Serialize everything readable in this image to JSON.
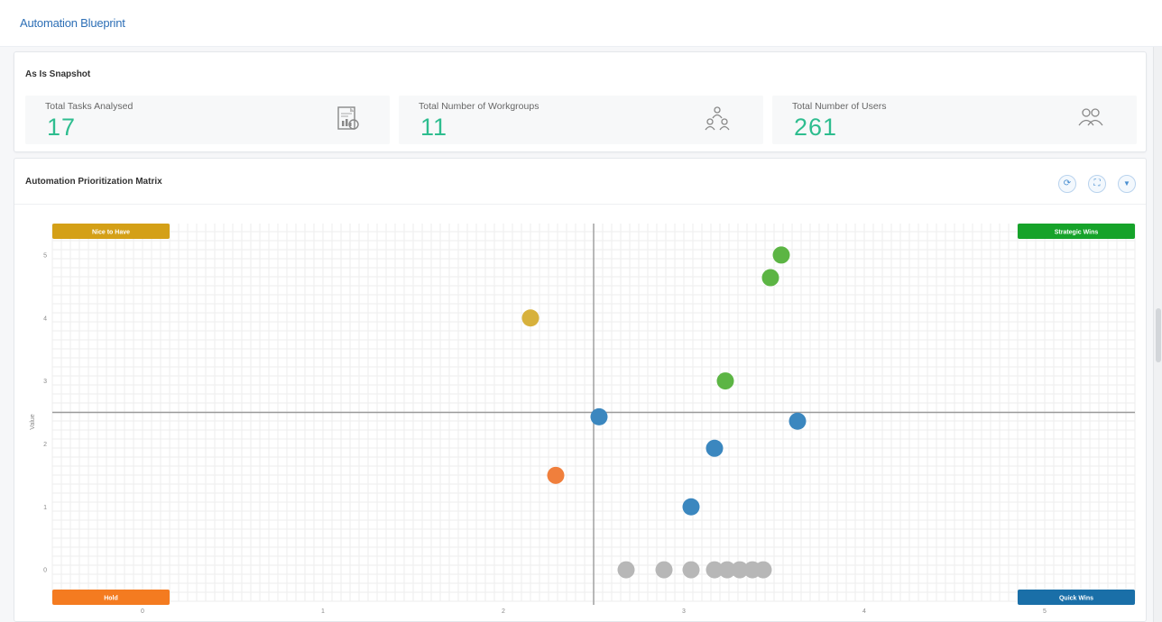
{
  "page": {
    "title": "Automation Blueprint"
  },
  "snapshot": {
    "title": "As Is Snapshot",
    "stats": [
      {
        "label": "Total Tasks Analysed",
        "value": "17",
        "icon": "report-icon"
      },
      {
        "label": "Total Number of Workgroups",
        "value": "11",
        "icon": "workgroup-icon"
      },
      {
        "label": "Total Number of Users",
        "value": "261",
        "icon": "users-icon"
      }
    ]
  },
  "matrix": {
    "title": "Automation Prioritization Matrix",
    "toolbar": [
      {
        "name": "refresh-icon",
        "glyph": "⟳"
      },
      {
        "name": "expand-icon",
        "glyph": "⛶"
      },
      {
        "name": "filter-icon",
        "glyph": "▼"
      }
    ]
  },
  "chart_data": {
    "type": "scatter",
    "xlabel": "",
    "ylabel": "Value",
    "x_ticks": [
      "0",
      "1",
      "2",
      "3",
      "4",
      "5"
    ],
    "y_ticks": [
      "0",
      "1",
      "2",
      "3",
      "4",
      "5"
    ],
    "xlim": [
      -0.5,
      5.5
    ],
    "ylim": [
      -0.5,
      5.5
    ],
    "divider": {
      "x": 2.5,
      "y": 2.5
    },
    "grid": true,
    "quadrants": [
      {
        "label": "Nice to Have",
        "position": "top-left",
        "color": "#d4a017"
      },
      {
        "label": "Strategic Wins",
        "position": "top-right",
        "color": "#16a32a"
      },
      {
        "label": "Hold",
        "position": "bottom-left",
        "color": "#f47b20"
      },
      {
        "label": "Quick Wins",
        "position": "bottom-right",
        "color": "#1a6fa8"
      }
    ],
    "series": [
      {
        "color": "#5cb544",
        "points": [
          [
            3.54,
            5.0
          ],
          [
            3.48,
            4.64
          ],
          [
            3.23,
            3.0
          ]
        ]
      },
      {
        "color": "#d7b13c",
        "points": [
          [
            2.15,
            4.0
          ]
        ]
      },
      {
        "color": "#3b87bf",
        "points": [
          [
            2.53,
            2.43
          ],
          [
            3.63,
            2.36
          ],
          [
            3.17,
            1.93
          ],
          [
            3.04,
            1.0
          ]
        ]
      },
      {
        "color": "#f07f3c",
        "points": [
          [
            2.29,
            1.5
          ]
        ]
      },
      {
        "color": "#b7b7b7",
        "points": [
          [
            2.68,
            0.0
          ],
          [
            2.89,
            0.0
          ],
          [
            3.04,
            0.0
          ],
          [
            3.17,
            0.0
          ],
          [
            3.24,
            0.0
          ],
          [
            3.31,
            0.0
          ],
          [
            3.38,
            0.0
          ],
          [
            3.44,
            0.0
          ]
        ]
      }
    ]
  }
}
